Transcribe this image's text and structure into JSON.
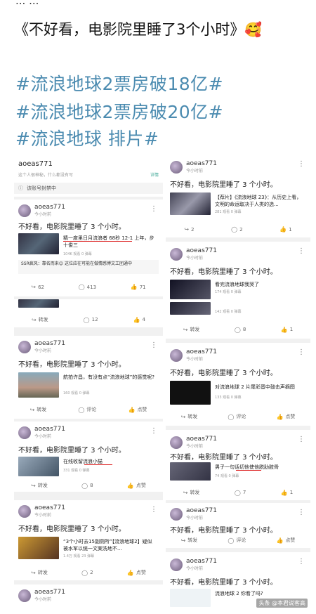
{
  "page": {
    "topline": "... ...",
    "title": "《不好看，电影院里睡了3个小时》",
    "title_emoji": "🥰",
    "hashtags": [
      "#流浪地球2票房破18亿#",
      "#流浪地球2票房破20亿#",
      "#流浪地球 排片#"
    ]
  },
  "left": {
    "profile": {
      "name": "aoeas771",
      "bio": "这个人很神秘，什么都没有写",
      "follow": "详情",
      "notice": "该账号封禁中"
    },
    "user": "aoeas771",
    "time": "今小时前",
    "post_text": "不好看，电影院里睡了 3 个小时。",
    "cards": [
      {
        "video_title": "精一度里日月流浪者 68秒 12-1 上年，步十俊三",
        "video_meta": "104K 观看 0 弹幕",
        "comment_user": "SSR疯风：",
        "comment": "靠名而来😊 这位应在可能在做情感博文工团通中",
        "a1": "62",
        "a2": "413",
        "a3": "71"
      },
      {
        "a1": "转发",
        "a2": "12",
        "a3": "4"
      },
      {
        "video_title": "航拍许昌，有没有点“流浪地球”的感觉呢?",
        "video_meta": "160 观看 0 弹幕",
        "a1": "转发",
        "a2": "评论",
        "a3": "点赞"
      },
      {
        "video_title": "在线收留流浪小猫",
        "video_meta": "331 观看 0 弹幕",
        "a1": "转发",
        "a2": "8",
        "a3": "点赞"
      },
      {
        "video_title": "“3个小时去15副厕所”【流浪地球2】疑似被水军以统一文案洗地不...",
        "video_meta": "1.4万 观看 23 弹幕",
        "a1": "转发",
        "a2": "2",
        "a3": "点赞"
      },
      {}
    ]
  },
  "right": {
    "user": "aoeas771",
    "time": "今小时前",
    "post_text": "不好看，电影院里睡了 3 个小时。",
    "cards": [
      {
        "video_title": "【荐片】《流浪地球 23》：从历史上看，文明的命运取决于人类的选...",
        "video_meta": "281 观看 0 弹幕",
        "a1": "2",
        "a2": "2",
        "a3": "1"
      },
      {
        "video_title": "看完流浪地球我哭了",
        "video_meta": "174 观看 0 弹幕",
        "video_meta2": "142 观看 0 弹幕",
        "a1": "转发",
        "a2": "8",
        "a3": "1"
      },
      {
        "video_title": "对流浪地球 2 片尾彩蛋中鼓击声摘图",
        "video_meta": "133 观看 0 弹幕",
        "a1": "转发",
        "a2": "评论",
        "a3": "点赞"
      },
      {
        "video_title": "男子一句话切他使他脱肋肢骨",
        "video_meta": "74 观看 0 弹幕",
        "a1": "转发",
        "a2": "7",
        "a3": "1"
      },
      {
        "a1": "转发",
        "a2": "评论",
        "a3": "点赞"
      },
      {
        "video_title": "流浪地球 2 你看了吗?",
        "watermark": "头条 @本君说客高"
      }
    ]
  }
}
